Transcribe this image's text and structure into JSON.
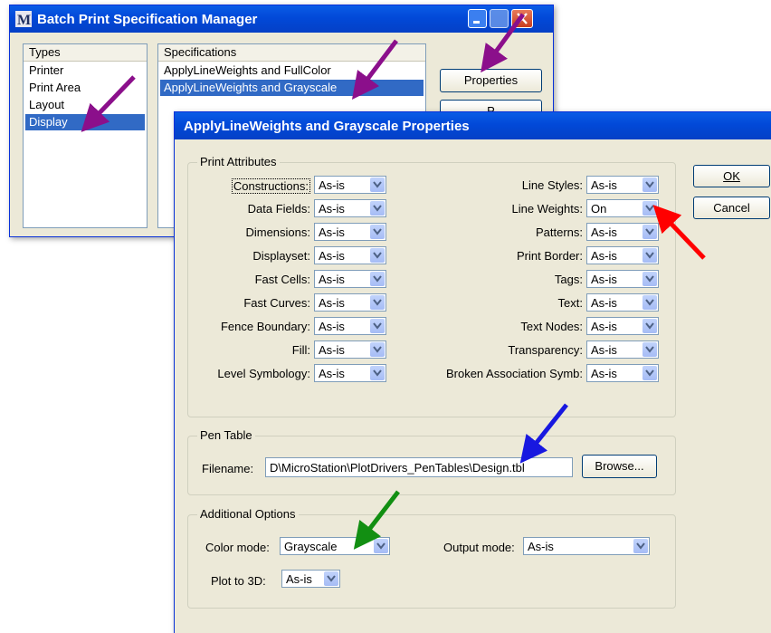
{
  "colors": {
    "title_blue": "#0a5ce6",
    "selection": "#316ac5",
    "face": "#ece9d8",
    "arrow_purple": "#8b0f8b",
    "arrow_red": "#ff0000",
    "arrow_blue": "#1818e0",
    "arrow_green": "#128f12"
  },
  "batch": {
    "title": "Batch Print Specification Manager",
    "types_header": "Types",
    "types": [
      "Printer",
      "Print Area",
      "Layout",
      "Display"
    ],
    "selected_type": "Display",
    "specs_header": "Specifications",
    "specs": [
      "ApplyLineWeights and FullColor",
      "ApplyLineWeights and Grayscale"
    ],
    "selected_spec": "ApplyLineWeights and Grayscale",
    "properties_label": "Properties",
    "hidden_button_fragment": "P"
  },
  "props": {
    "title": "ApplyLineWeights and Grayscale Properties",
    "ok_label": "OK",
    "cancel_label": "Cancel",
    "print_attributes_label": "Print Attributes",
    "left_attrs": [
      {
        "label": "Constructions:",
        "value": "As-is"
      },
      {
        "label": "Data Fields:",
        "value": "As-is"
      },
      {
        "label": "Dimensions:",
        "value": "As-is"
      },
      {
        "label": "Displayset:",
        "value": "As-is"
      },
      {
        "label": "Fast Cells:",
        "value": "As-is"
      },
      {
        "label": "Fast Curves:",
        "value": "As-is"
      },
      {
        "label": "Fence Boundary:",
        "value": "As-is"
      },
      {
        "label": "Fill:",
        "value": "As-is"
      },
      {
        "label": "Level Symbology:",
        "value": "As-is"
      }
    ],
    "right_attrs": [
      {
        "label": "Line Styles:",
        "value": "As-is"
      },
      {
        "label": "Line Weights:",
        "value": "On"
      },
      {
        "label": "Patterns:",
        "value": "As-is"
      },
      {
        "label": "Print Border:",
        "value": "As-is"
      },
      {
        "label": "Tags:",
        "value": "As-is"
      },
      {
        "label": "Text:",
        "value": "As-is"
      },
      {
        "label": "Text Nodes:",
        "value": "As-is"
      },
      {
        "label": "Transparency:",
        "value": "As-is"
      },
      {
        "label": "Broken Association Symb:",
        "value": "As-is"
      }
    ],
    "pen_table_label": "Pen Table",
    "filename_label": "Filename:",
    "filename_value": "D\\MicroStation\\PlotDrivers_PenTables\\Design.tbl",
    "browse_label": "Browse...",
    "additional_label": "Additional Options",
    "color_mode_label": "Color mode:",
    "color_mode_value": "Grayscale",
    "output_mode_label": "Output mode:",
    "output_mode_value": "As-is",
    "plot3d_label": "Plot to 3D:",
    "plot3d_value": "As-is"
  }
}
